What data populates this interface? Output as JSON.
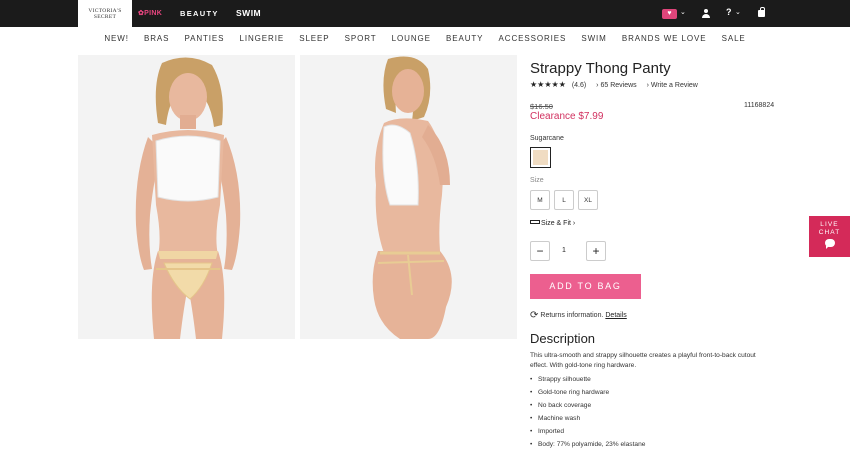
{
  "topbar": {
    "brand_vs_line1": "VICTORIA'S",
    "brand_vs_line2": "SECRET",
    "brand_pink": "PINK",
    "brand_beauty": "BEAUTY",
    "brand_swim": "SWIM",
    "icons": [
      "heart-icon",
      "chevron-down-icon",
      "account-icon",
      "help-icon",
      "chevron-down-icon",
      "bag-icon"
    ],
    "help_glyph": "?"
  },
  "nav": {
    "items": [
      "NEW!",
      "BRAS",
      "PANTIES",
      "LINGERIE",
      "SLEEP",
      "SPORT",
      "LOUNGE",
      "BEAUTY",
      "ACCESSORIES",
      "SWIM",
      "BRANDS WE LOVE",
      "SALE"
    ]
  },
  "product": {
    "title": "Strappy Thong Panty",
    "stars": "★★★★★",
    "rating": "(4.6)",
    "reviews_link": "65 Reviews",
    "write_review": "Write a Review",
    "old_price": "$16.50",
    "sale_price": "Clearance $7.99",
    "sku": "11168824",
    "color_name": "Sugarcane",
    "swatch_color": "#f0dcc2",
    "size_label": "Size",
    "sizes": [
      "M",
      "L",
      "XL"
    ],
    "size_fit": "Size & Fit",
    "quantity": "1",
    "minus": "−",
    "plus": "+",
    "add_to_bag": "ADD TO BAG",
    "returns_text": "Returns information.",
    "returns_link": "Details",
    "description_title": "Description",
    "description": "This ultra-smooth and strappy silhouette creates a playful front-to-back cutout effect. With gold-tone ring hardware.",
    "features": [
      "Strappy silhouette",
      "Gold-tone ring hardware",
      "No back coverage",
      "Machine wash",
      "Imported",
      "Body: 77% polyamide, 23% elastane"
    ]
  },
  "live_chat": {
    "line1": "LIVE",
    "line2": "CHAT"
  },
  "colors": {
    "accent_pink": "#ec5f8f",
    "clearance_red": "#d1305f",
    "chat_red": "#d42a59",
    "topbar": "#1b1b1b"
  }
}
